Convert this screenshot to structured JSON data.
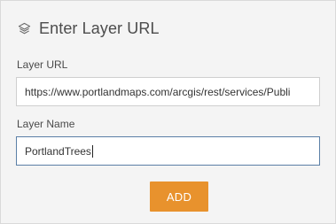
{
  "header": {
    "icon": "layers-icon",
    "title": "Enter Layer URL"
  },
  "form": {
    "url_label": "Layer URL",
    "url_value": "https://www.portlandmaps.com/arcgis/rest/services/Publi",
    "name_label": "Layer Name",
    "name_value": "PortlandTrees",
    "add_label": "ADD"
  },
  "colors": {
    "panel_bg": "#f4f4f4",
    "accent_button": "#e8922d",
    "focus_border": "#5b7fa6"
  }
}
